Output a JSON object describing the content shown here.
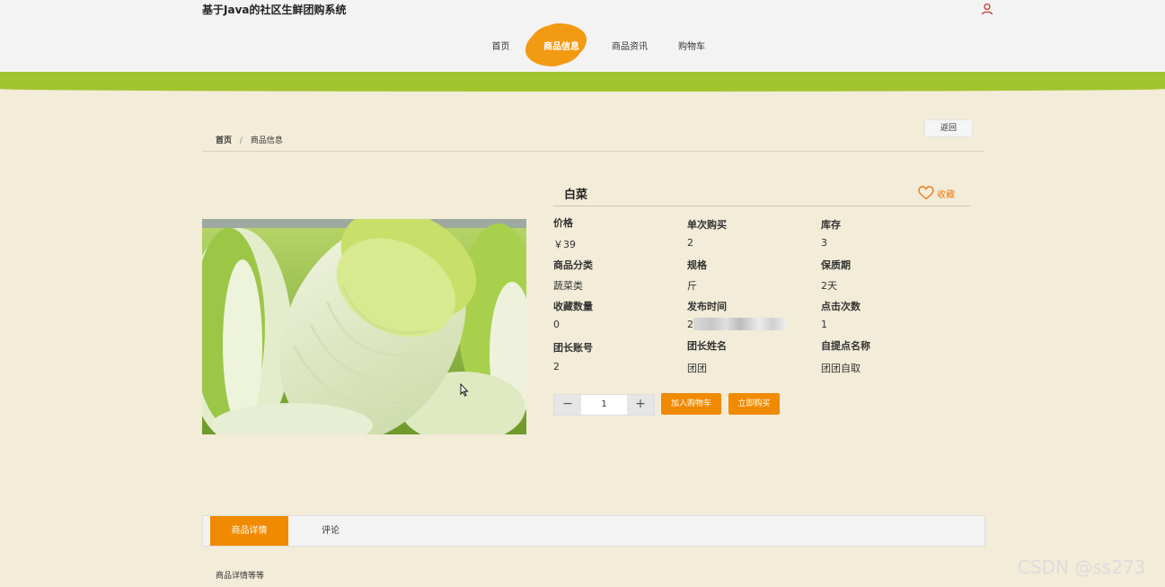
{
  "header": {
    "site_title": "基于Java的社区生鲜团购系统",
    "nav": [
      {
        "label": "首页"
      },
      {
        "label": "商品信息",
        "active": true
      },
      {
        "label": "商品资讯"
      },
      {
        "label": "购物车"
      }
    ],
    "user_icon": "user-icon"
  },
  "breadcrumb": {
    "home": "首页",
    "separator": "/",
    "current": "商品信息"
  },
  "back_button": "返回",
  "product": {
    "name": "白菜",
    "favorite_label": "收藏",
    "attributes": [
      {
        "label": "价格",
        "value": "￥39"
      },
      {
        "label": "单次购买",
        "value": "2"
      },
      {
        "label": "库存",
        "value": "3"
      },
      {
        "label": "商品分类",
        "value": "蔬菜类"
      },
      {
        "label": "规格",
        "value": "斤"
      },
      {
        "label": "保质期",
        "value": "2天"
      },
      {
        "label": "收藏数量",
        "value": "0"
      },
      {
        "label": "发布时间",
        "value": "2"
      },
      {
        "label": "点击次数",
        "value": "1"
      },
      {
        "label": "团长账号",
        "value": "2"
      },
      {
        "label": "团长姓名",
        "value": "团团"
      },
      {
        "label": "自提点名称",
        "value": "团团自取"
      }
    ],
    "quantity": "1",
    "add_to_cart": "加入购物车",
    "buy_now": "立即购买"
  },
  "tabs": [
    {
      "label": "商品详情",
      "active": true
    },
    {
      "label": "评论"
    }
  ],
  "detail_text": "商品详情等等",
  "watermark": "CSDN @ss273",
  "colors": {
    "accent": "#f08a00",
    "band": "#a2c42e",
    "background": "#f2ecd8",
    "favorite": "#f07a16"
  }
}
